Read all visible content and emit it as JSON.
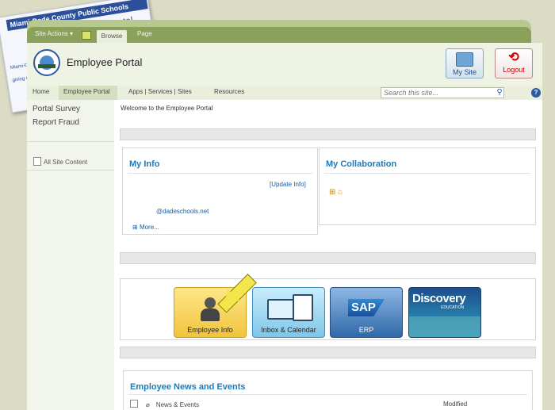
{
  "id_card": {
    "band": "Miami-Dade County Public Schools",
    "subtitle": "Employee Portal",
    "mini_text": "Miami-Dade",
    "mini_text2": "giving our"
  },
  "ribbon": {
    "site_actions": "Site Actions ▾",
    "browse": "Browse",
    "page": "Page"
  },
  "header": {
    "title": "Employee Portal",
    "my_site": "My Site",
    "logout": "Logout"
  },
  "topnav": {
    "home": "Home",
    "employee_portal": "Employee Portal",
    "apps": "Apps | Services | Sites",
    "resources": "Resources",
    "search_placeholder": "Search this site...",
    "help": "?"
  },
  "leftnav": {
    "items": [
      "Portal Survey",
      "Report Fraud"
    ],
    "all_site_content": "All Site Content"
  },
  "main": {
    "welcome": "Welcome to the Employee Portal",
    "my_info": {
      "title": "My Info",
      "update_link": "[Update Info]",
      "email": "@dadeschools.net",
      "more": "More..."
    },
    "my_collaboration": {
      "title": "My Collaboration"
    },
    "tiles": [
      {
        "label": "Employee Info"
      },
      {
        "label": "Inbox & Calendar"
      },
      {
        "label": "ERP",
        "logo": "SAP"
      },
      {
        "label": "Discovery",
        "sublabel": "EDUCATION"
      }
    ],
    "news": {
      "title": "Employee News and Events",
      "col_title": "News & Events",
      "col_modified": "Modified"
    }
  }
}
